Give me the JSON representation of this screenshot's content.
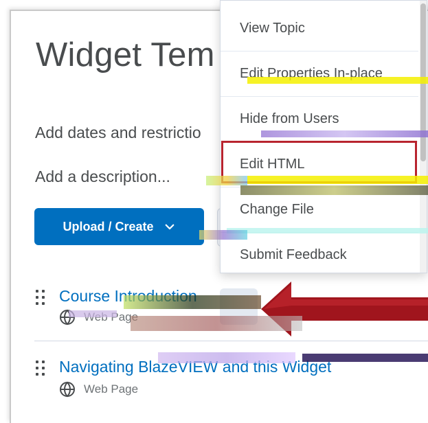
{
  "page": {
    "title": "Widget Tem",
    "add_dates_label": "Add dates and restrictio",
    "add_description_label": "Add a description...",
    "upload_create_label": "Upload / Create"
  },
  "topics": [
    {
      "title": "Course Introduction",
      "type": "Web Page"
    },
    {
      "title": "Navigating BlazeVIEW and this Widget",
      "type": "Web Page"
    }
  ],
  "context_menu": {
    "items": [
      {
        "label": "View Topic"
      },
      {
        "label": "Edit Properties In-place"
      },
      {
        "label": "Hide from Users"
      },
      {
        "label": "Edit HTML"
      },
      {
        "label": "Change File"
      },
      {
        "label": "Submit Feedback"
      }
    ],
    "highlighted_index": 3
  },
  "colors": {
    "primary": "#006fbf",
    "highlight": "#b8242f",
    "text": "#494c4e",
    "link": "#006fbf"
  },
  "icons": {
    "upload_chevron": "chevron-down-icon",
    "drag": "drag-handle-icon",
    "web_page": "globe-icon",
    "annotation": "red-arrow-icon"
  }
}
